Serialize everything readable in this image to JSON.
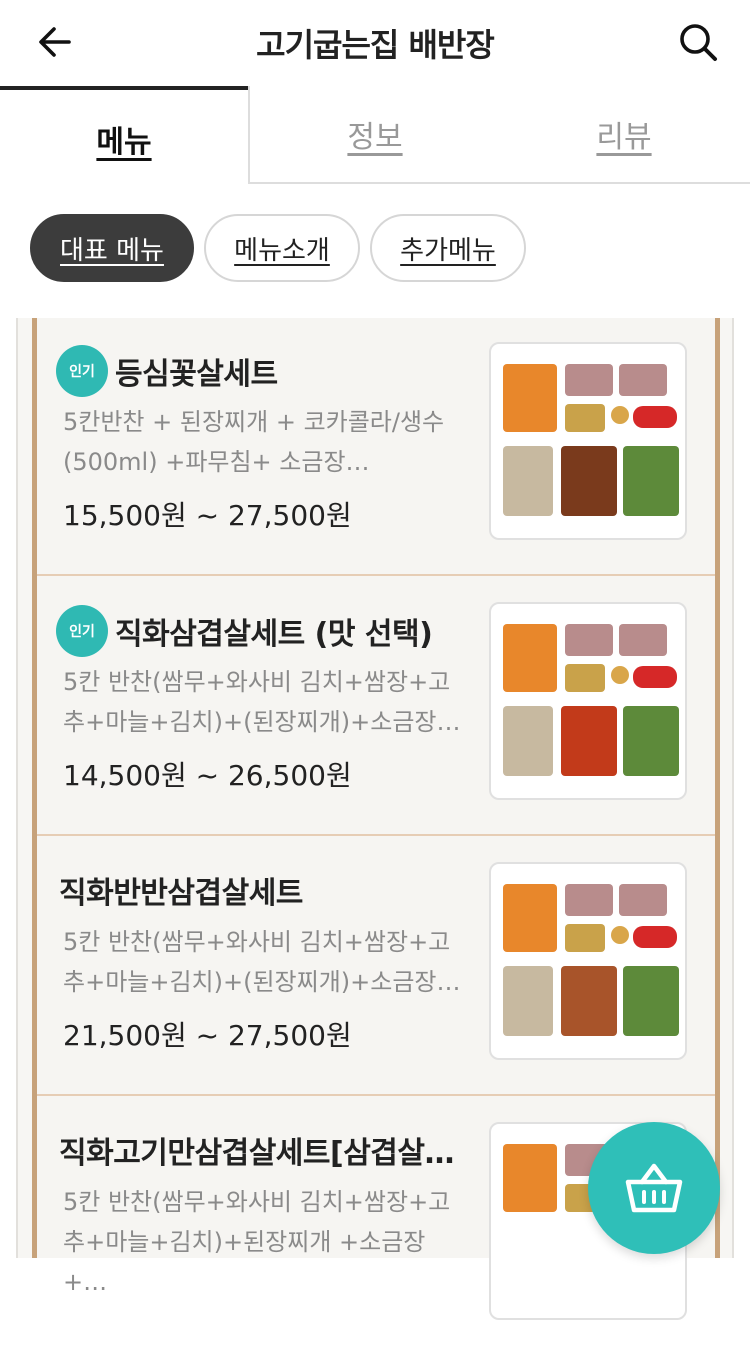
{
  "header": {
    "title": "고기굽는집 배반장",
    "back_icon": "arrow-left-icon",
    "search_icon": "search-icon"
  },
  "tabs": [
    {
      "label": "메뉴"
    },
    {
      "label": "정보"
    },
    {
      "label": "리뷰"
    }
  ],
  "chips": [
    {
      "label": "대표 메뉴"
    },
    {
      "label": "메뉴소개"
    },
    {
      "label": "추가메뉴"
    }
  ],
  "menu_items": [
    {
      "badge": "인기",
      "name": "등심꽃살세트",
      "desc": "5칸반찬 + 된장찌개 + 코카콜라/생수(500ml) +파무침+ 소금장…",
      "price": "15,500원 ~ 27,500원"
    },
    {
      "badge": "인기",
      "name": "직화삼겹살세트 (맛 선택)",
      "desc": "5칸 반찬(쌈무+와사비 김치+쌈장+고추+마늘+김치)+(된장찌개)+소금장…",
      "price": "14,500원 ~ 26,500원"
    },
    {
      "badge": "",
      "name": "직화반반삼겹살세트",
      "desc": "5칸 반찬(쌈무+와사비 김치+쌈장+고추+마늘+김치)+(된장찌개)+소금장…",
      "price": "21,500원 ~ 27,500원"
    },
    {
      "badge": "",
      "name": "직화고기만삼겹살세트[삼겹살…",
      "desc": "5칸 반찬(쌈무+와사비 김치+쌈장+고추+마늘+김치)+된장찌개 +소금장+…",
      "price": ""
    }
  ],
  "colors": {
    "accent": "#2fbfb8",
    "frame": "#c7a27a",
    "active_chip": "#3c3c3c"
  },
  "cart_icon": "shopping-basket-icon"
}
